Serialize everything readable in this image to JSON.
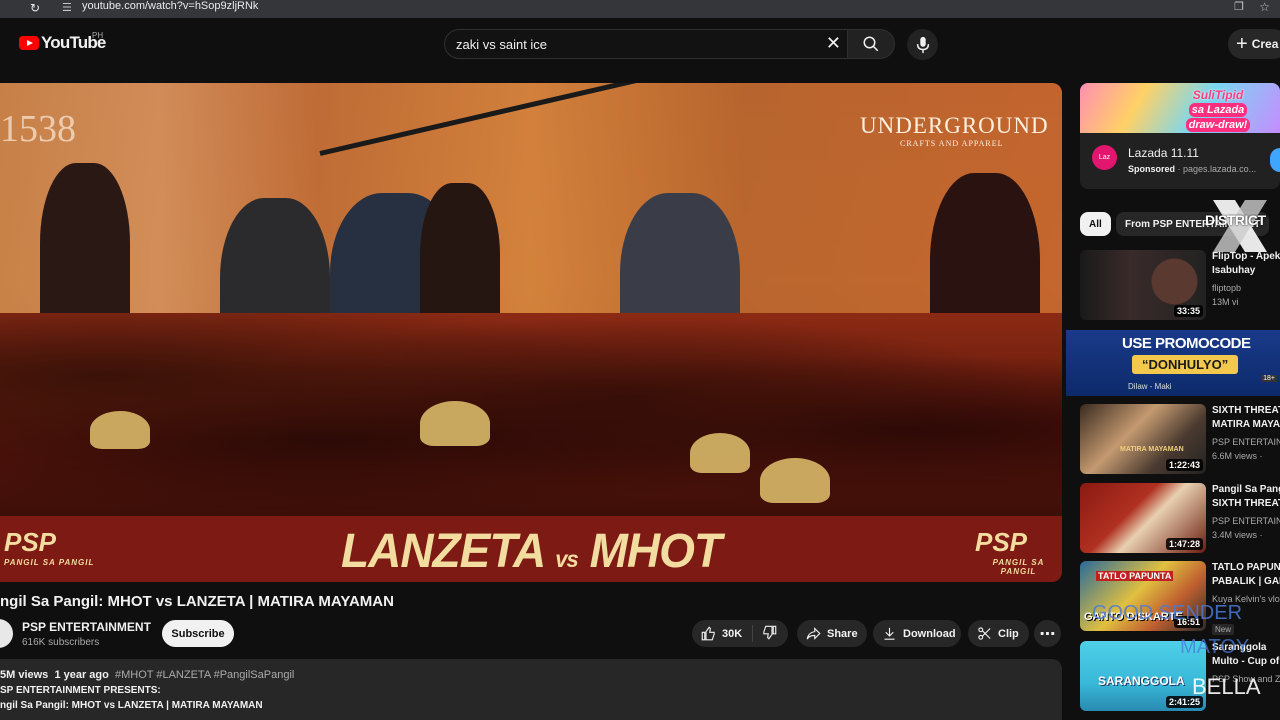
{
  "browser": {
    "url": "youtube.com/watch?v=hSop9zljRNk"
  },
  "header": {
    "logo_text": "YouTube",
    "region": "PH",
    "search_query": "zaki vs saint ice",
    "create_label": "Crea"
  },
  "player": {
    "stage_number": "1538",
    "brand_line1": "UNDERGROUND",
    "brand_line2": "CRAFTS AND APPAREL",
    "title_left": "LANZETA",
    "title_vs": "vs",
    "title_right": "MHOT",
    "psp_logo": "PSP",
    "psp_sub": "PANGIL SA PANGIL"
  },
  "video": {
    "title": "ngil Sa Pangil: MHOT vs LANZETA | MATIRA MAYAMAN",
    "channel_name": "PSP ENTERTAINMENT",
    "subscribers": "616K subscribers",
    "subscribe_label": "Subscribe",
    "likes": "30K",
    "share_label": "Share",
    "download_label": "Download",
    "clip_label": "Clip",
    "more_label": "⋯"
  },
  "description": {
    "views": "5M views",
    "age": "1 year ago",
    "tags": "#MHOT #LANZETA #PangilSaPangil",
    "line1": "SP ENTERTAINMENT PRESENTS:",
    "line2": "ngil Sa Pangil: MHOT vs LANZETA | MATIRA MAYAMAN"
  },
  "sidebar": {
    "ad": {
      "headline_1": "SuliTipid",
      "headline_2": "sa Lazada",
      "headline_3": "draw-draw!",
      "logo_text": "Laz",
      "title": "Lazada 11.11",
      "sponsored": "Sponsored",
      "domain": "· pages.lazada.co..."
    },
    "chips": [
      "All",
      "From PSP ENTERTAINMENT"
    ],
    "overlay_logo": "DISTRICT",
    "promo": {
      "line1": "USE PROMOCODE",
      "line2": "“DONHULYO”",
      "line3": "Dilaw - Maki",
      "age": "18+"
    },
    "recs": [
      {
        "t1": "FlipTop - Apek",
        "t2": "Isabuhay",
        "channel": "fliptopb",
        "views": "13M vi",
        "duration": "33:35"
      },
      {
        "t1": "SIXTH THREAT",
        "t2": "MATIRA MAYA",
        "channel": "PSP ENTERTAIN",
        "views": "6.6M views ·",
        "duration": "1:22:43"
      },
      {
        "t1": "Pangil Sa Pang",
        "t2": "SIXTH THREAT",
        "channel": "PSP ENTERTAIN",
        "views": "3.4M views ·",
        "duration": "1:47:28"
      },
      {
        "t1": "TATLO PAPUN",
        "t2": "PABALIK | GAN",
        "channel": "Kuya Kelvin's vlog",
        "views": "",
        "duration": "16:51"
      },
      {
        "t1": "Saranggola",
        "t2": "Multo - Cup of",
        "channel": "PSP Show and Z",
        "views": "",
        "duration": "2:41:25"
      }
    ],
    "thumb_text": {
      "rec2_title": "MATIRA MAYAMAN",
      "rec4_a": "TATLO PAPUNTA",
      "rec4_b": "GANTO DISKARTE",
      "rec5": "SARANGGOLA"
    },
    "overlay1": "GOOD SENDER",
    "overlay2": "MATOY",
    "overlay3": "BELLA",
    "new_badge": "New"
  }
}
